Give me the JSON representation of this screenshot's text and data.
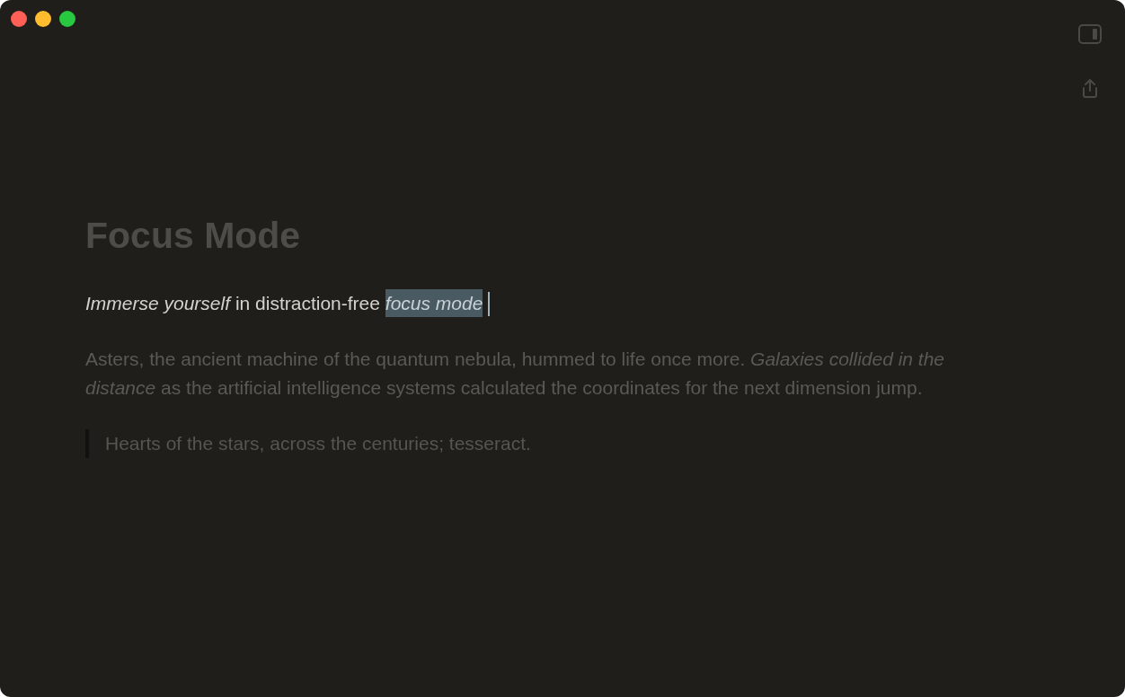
{
  "title": {
    "text": "Focus Mode",
    "focused": false
  },
  "blocks": [
    {
      "kind": "paragraph",
      "focused": true,
      "text": "*Immerse yourself* in distraction-free ",
      "selection": "*focus mode*"
    },
    {
      "kind": "paragraph",
      "focused": false,
      "text": "Asters, the ancient machine of the quantum nebula, hummed to life once more. *Galaxies collided in the distance* as the artificial intelligence systems calculated the coordinates for the next dimension jump."
    },
    {
      "kind": "blockquote",
      "focused": false,
      "text": "Hearts of the stars, across the centuries; tesseract."
    }
  ]
}
